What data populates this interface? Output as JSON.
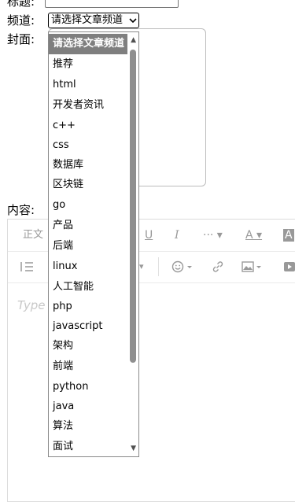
{
  "form": {
    "title_label": "标题:",
    "channel_label": "频道:",
    "cover_label": "封面:",
    "content_label": "内容:",
    "channel_selected": "请选择文章频道"
  },
  "dropdown": {
    "options": [
      "请选择文章频道",
      "推荐",
      "html",
      "开发者资讯",
      "c++",
      "css",
      "数据库",
      "区块链",
      "go",
      "产品",
      "后端",
      "linux",
      "人工智能",
      "php",
      "javascript",
      "架构",
      "前端",
      "python",
      "java",
      "算法",
      "面试"
    ],
    "selected_index": 0
  },
  "editor": {
    "paragraph_label": "正文",
    "placeholder": "Type"
  }
}
